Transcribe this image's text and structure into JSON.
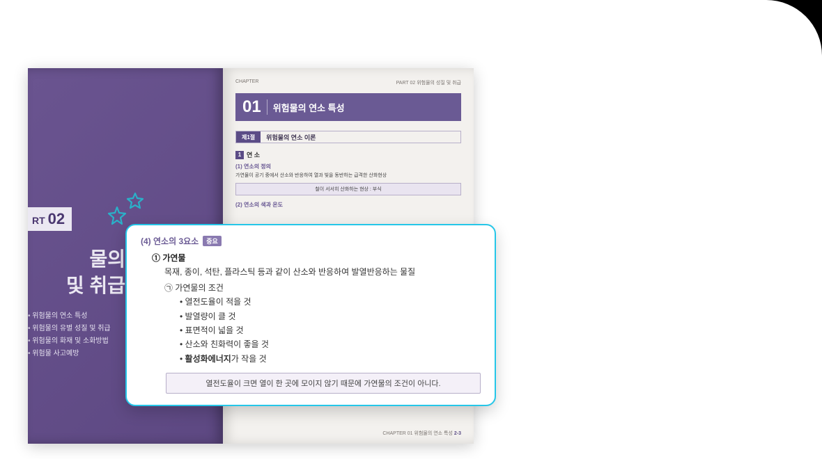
{
  "leftPage": {
    "partLabel": "RT",
    "partNumber": "02",
    "titleLine1": "물의",
    "titleLine2": "및 취급",
    "chapters": [
      "위험물의 연소 특성",
      "위험물의 유별 성질 및 취급",
      "위험물의 화재 및 소화방법",
      "위험물 사고예방"
    ]
  },
  "rightPage": {
    "chapterTag": "CHAPTER",
    "partCaption": "PART 02 위험물의 성질 및 취급",
    "chapterNumber": "01",
    "chapterTitle": "위험물의 연소 특성",
    "sectionTab": "제1절",
    "sectionTitle": "위험물의 연소 이론",
    "blockNum": "1",
    "blockLabel": "연 소",
    "sub1": "(1) 연소의 정의",
    "sub1Body": "가연물이 공기 중에서 산소와 반응하여 열과 빛을 동반하는 급격한 산화현상",
    "noteBox": "철이 서서히 산화하는 현상 : 부식",
    "sub2": "(2) 연소의 색과 온도",
    "footer": "CHAPTER 01 위험물의 연소 특성",
    "pageNum": "2-3"
  },
  "callout": {
    "title": "(4) 연소의 3요소",
    "badge": "중요",
    "itemHead": "① 가연물",
    "desc": "목재, 종이, 석탄, 플라스틱 등과 같이 산소와 반응하여 발열반응하는 물질",
    "subHead": "㉠ 가연물의 조건",
    "bullets": [
      "열전도율이 적을 것",
      "발열량이 클 것",
      "표면적이 넓을 것",
      "산소와 친화력이 좋을 것"
    ],
    "boldBulletPre": "활성화에너지",
    "boldBulletPost": "가 작을 것",
    "note": "열전도율이 크면 열이 한 곳에 모이지 않기 때문에 가연물의 조건이 아니다."
  }
}
